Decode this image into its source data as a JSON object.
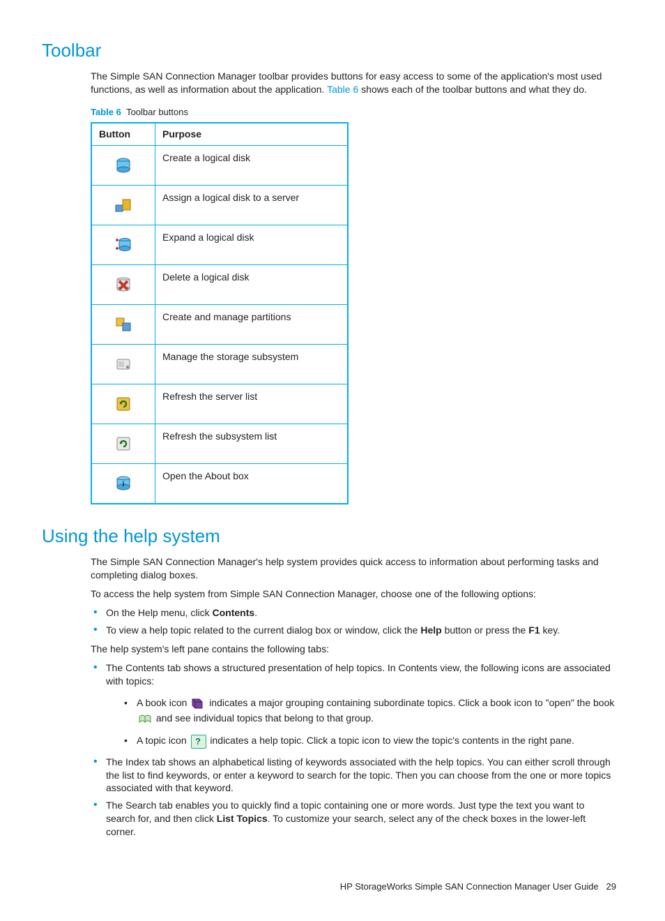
{
  "section1": {
    "heading": "Toolbar",
    "intro_a": "The Simple SAN Connection Manager toolbar provides buttons for easy access to some of the application's most used functions, as well as information about the application. ",
    "intro_link": "Table 6",
    "intro_b": " shows each of the toolbar buttons and what they do.",
    "table_label": "Table 6",
    "table_title": "Toolbar buttons",
    "th_button": "Button",
    "th_purpose": "Purpose",
    "rows": [
      {
        "purpose": "Create a logical disk"
      },
      {
        "purpose": "Assign a logical disk to a server"
      },
      {
        "purpose": "Expand a logical disk"
      },
      {
        "purpose": "Delete a logical disk"
      },
      {
        "purpose": "Create and manage partitions"
      },
      {
        "purpose": "Manage the storage subsystem"
      },
      {
        "purpose": "Refresh the server list"
      },
      {
        "purpose": "Refresh the subsystem list"
      },
      {
        "purpose": "Open the About box"
      }
    ]
  },
  "section2": {
    "heading": "Using the help system",
    "p1": "The Simple SAN Connection Manager's help system provides quick access to information about performing tasks and completing dialog boxes.",
    "p2": "To access the help system from Simple SAN Connection Manager, choose one of the following options:",
    "b1_pre": "On the Help menu, click ",
    "b1_bold": "Contents",
    "b1_post": ".",
    "b2_pre": "To view a help topic related to the current dialog box or window, click the ",
    "b2_bold1": "Help",
    "b2_mid": " button or press the ",
    "b2_bold2": "F1",
    "b2_post": " key.",
    "p3": "The help system's left pane contains the following tabs:",
    "c1": "The Contents tab shows a structured presentation of help topics. In Contents view, the following icons are associated with topics:",
    "c1s1_a": "A book icon ",
    "c1s1_b": " indicates a major grouping containing subordinate topics. Click a book icon to \"open\" the book ",
    "c1s1_c": " and see individual topics that belong to that group.",
    "c1s2_a": "A topic icon ",
    "c1s2_b": " indicates a help topic. Click a topic icon to view the topic's contents in the right pane.",
    "c2": "The Index tab shows an alphabetical listing of keywords associated with the help topics. You can either scroll through the list to find keywords, or enter a keyword to search for the topic. Then you can choose from the one or more topics associated with that keyword.",
    "c3_pre": "The Search tab enables you to quickly find a topic containing one or more words. Just type the text you want to search for, and then click ",
    "c3_bold": "List Topics",
    "c3_post": ". To customize your search, select any of the check boxes in the lower-left corner."
  },
  "footer": {
    "text": "HP StorageWorks Simple SAN Connection Manager User Guide",
    "page": "29"
  }
}
